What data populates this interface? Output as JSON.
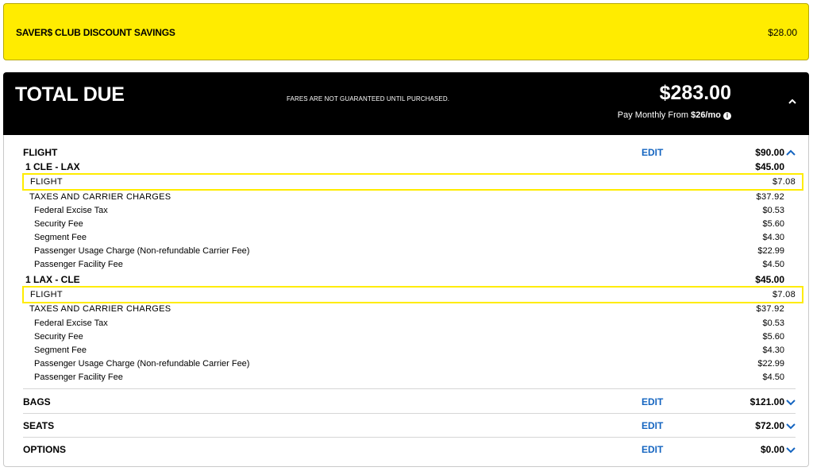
{
  "savers": {
    "label": "SAVER$ CLUB DISCOUNT SAVINGS",
    "amount": "$28.00"
  },
  "total": {
    "title": "TOTAL DUE",
    "note": "FARES ARE NOT GUARANTEED UNTIL PURCHASED.",
    "amount": "$283.00",
    "monthly_prefix": "Pay Monthly From",
    "monthly_amount": "$26/mo"
  },
  "flight": {
    "label": "FLIGHT",
    "edit": "EDIT",
    "amount": "$90.00",
    "legs": [
      {
        "route": "1 CLE - LAX",
        "amount": "$45.00",
        "fare_label": "FLIGHT",
        "fare_amount": "$7.08",
        "taxes_label": "TAXES AND CARRIER CHARGES",
        "taxes_amount": "$37.92",
        "fees": [
          {
            "name": "Federal Excise Tax",
            "amount": "$0.53"
          },
          {
            "name": "Security Fee",
            "amount": "$5.60"
          },
          {
            "name": "Segment Fee",
            "amount": "$4.30"
          },
          {
            "name": "Passenger Usage Charge (Non-refundable Carrier Fee)",
            "amount": "$22.99"
          },
          {
            "name": "Passenger Facility Fee",
            "amount": "$4.50"
          }
        ]
      },
      {
        "route": "1 LAX - CLE",
        "amount": "$45.00",
        "fare_label": "FLIGHT",
        "fare_amount": "$7.08",
        "taxes_label": "TAXES AND CARRIER CHARGES",
        "taxes_amount": "$37.92",
        "fees": [
          {
            "name": "Federal Excise Tax",
            "amount": "$0.53"
          },
          {
            "name": "Security Fee",
            "amount": "$5.60"
          },
          {
            "name": "Segment Fee",
            "amount": "$4.30"
          },
          {
            "name": "Passenger Usage Charge (Non-refundable Carrier Fee)",
            "amount": "$22.99"
          },
          {
            "name": "Passenger Facility Fee",
            "amount": "$4.50"
          }
        ]
      }
    ]
  },
  "bags": {
    "label": "BAGS",
    "edit": "EDIT",
    "amount": "$121.00"
  },
  "seats": {
    "label": "SEATS",
    "edit": "EDIT",
    "amount": "$72.00"
  },
  "options": {
    "label": "OPTIONS",
    "edit": "EDIT",
    "amount": "$0.00"
  },
  "colors": {
    "accent_yellow": "#ffec00",
    "link_blue": "#1565c0",
    "header_black": "#000000"
  },
  "icons": {
    "expanded": "chevron-up-icon",
    "collapsed": "chevron-down-icon",
    "info": "info-icon"
  }
}
